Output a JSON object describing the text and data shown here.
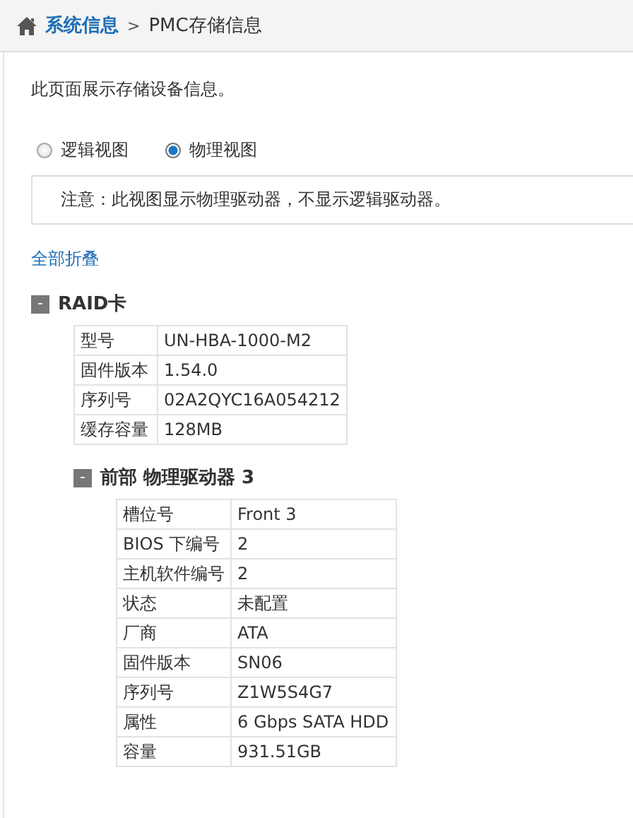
{
  "breadcrumb": {
    "parent": "系统信息",
    "separator": ">",
    "current": "PMC存储信息"
  },
  "description": "此页面展示存储设备信息。",
  "view_options": [
    {
      "label": "逻辑视图",
      "selected": false
    },
    {
      "label": "物理视图",
      "selected": true
    }
  ],
  "notice": "注意：此视图显示物理驱动器，不显示逻辑驱动器。",
  "collapse_all_link": "全部折叠",
  "sections": [
    {
      "toggle": "-",
      "title": "RAID卡",
      "expanded": true,
      "rows": [
        [
          "型号",
          "UN-HBA-1000-M2"
        ],
        [
          "固件版本",
          "1.54.0"
        ],
        [
          "序列号",
          "02A2QYC16A054212"
        ],
        [
          "缓存容量",
          "128MB"
        ]
      ],
      "children": [
        {
          "toggle": "-",
          "title": "前部 物理驱动器 3",
          "expanded": true,
          "rows": [
            [
              "槽位号",
              "Front 3"
            ],
            [
              "BIOS 下编号",
              "2"
            ],
            [
              "主机软件编号",
              "2"
            ],
            [
              "状态",
              "未配置"
            ],
            [
              "厂商",
              "ATA"
            ],
            [
              "固件版本",
              "SN06"
            ],
            [
              "序列号",
              "Z1W5S4G7"
            ],
            [
              "属性",
              "6 Gbps SATA HDD"
            ],
            [
              "容量",
              "931.51GB"
            ]
          ]
        }
      ]
    }
  ]
}
